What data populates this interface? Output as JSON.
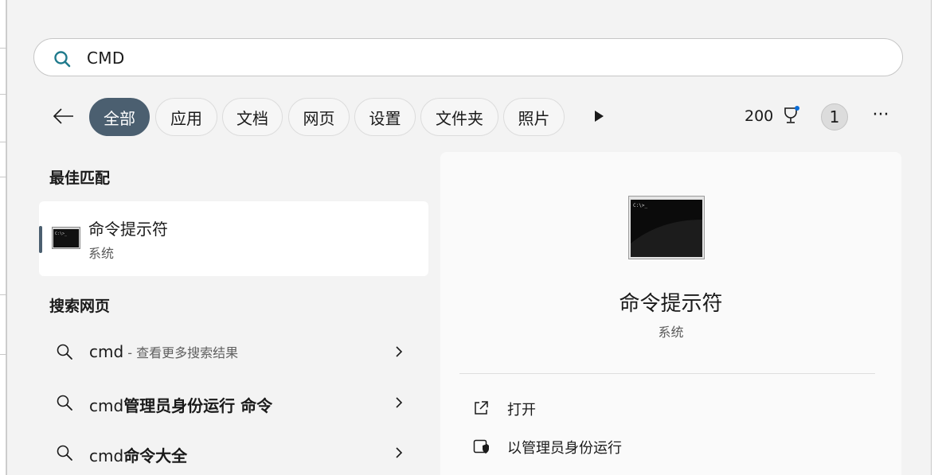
{
  "search": {
    "query": "CMD"
  },
  "filters": {
    "chips": [
      "全部",
      "应用",
      "文档",
      "网页",
      "设置",
      "文件夹",
      "照片"
    ],
    "points": "200",
    "badge_count": "1"
  },
  "best_match": {
    "heading": "最佳匹配",
    "item": {
      "title": "命令提示符",
      "subtitle": "系统"
    }
  },
  "web_search": {
    "heading": "搜索网页",
    "rows": [
      {
        "prefix": "cmd",
        "bold": "",
        "dim": " - 查看更多搜索结果"
      },
      {
        "prefix": "cmd",
        "bold": "管理员身份运行 命令",
        "dim": ""
      },
      {
        "prefix": "cmd",
        "bold": "命令大全",
        "dim": ""
      }
    ]
  },
  "details": {
    "title": "命令提示符",
    "subtitle": "系统",
    "actions": [
      {
        "label": "打开",
        "icon": "open-external-icon"
      },
      {
        "label": "以管理员身份运行",
        "icon": "admin-shield-icon"
      }
    ]
  },
  "colors": {
    "accent": "#4b5f70",
    "search_icon": "#1f7a8c",
    "trophy_dot": "#0a6cd6"
  }
}
